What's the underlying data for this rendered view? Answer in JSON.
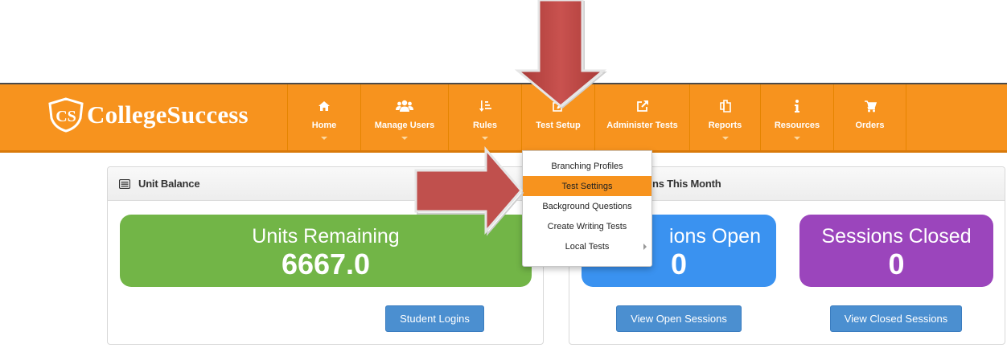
{
  "brand": {
    "name": "CollegeSuccess",
    "logo_letters": "CS"
  },
  "nav": {
    "items": [
      {
        "label": "Home",
        "icon": "home-icon",
        "caret": true
      },
      {
        "label": "Manage Users",
        "icon": "users-icon",
        "caret": true
      },
      {
        "label": "Rules",
        "icon": "sort-icon",
        "caret": true
      },
      {
        "label": "Test Setup",
        "icon": "edit-icon",
        "caret": false
      },
      {
        "label": "Administer Tests",
        "icon": "external-link-icon",
        "caret": false
      },
      {
        "label": "Reports",
        "icon": "copy-icon",
        "caret": true
      },
      {
        "label": "Resources",
        "icon": "info-icon",
        "caret": true
      },
      {
        "label": "Orders",
        "icon": "cart-icon",
        "caret": false
      }
    ]
  },
  "dropdown": {
    "items": [
      {
        "label": "Branching Profiles"
      },
      {
        "label": "Test Settings",
        "highlighted": true
      },
      {
        "label": "Background Questions"
      },
      {
        "label": "Create Writing Tests"
      },
      {
        "label": "Local Tests",
        "submenu": true
      }
    ]
  },
  "unit_panel": {
    "title": "Unit Balance",
    "box": {
      "label": "Units Remaining",
      "value": "6667.0",
      "color": "#72b547"
    },
    "button": "Student Logins"
  },
  "sessions_panel": {
    "title_visible": "ns This Month",
    "open": {
      "label_visible": "ions Open",
      "value": "0",
      "color": "#3a92f0"
    },
    "closed": {
      "label": "Sessions Closed",
      "value": "0",
      "color": "#9b45bc"
    },
    "open_button": "View Open Sessions",
    "closed_button": "View Closed Sessions"
  },
  "colors": {
    "navbar": "#f7931e",
    "button": "#4b8fd0",
    "arrow": "#c0504d"
  }
}
